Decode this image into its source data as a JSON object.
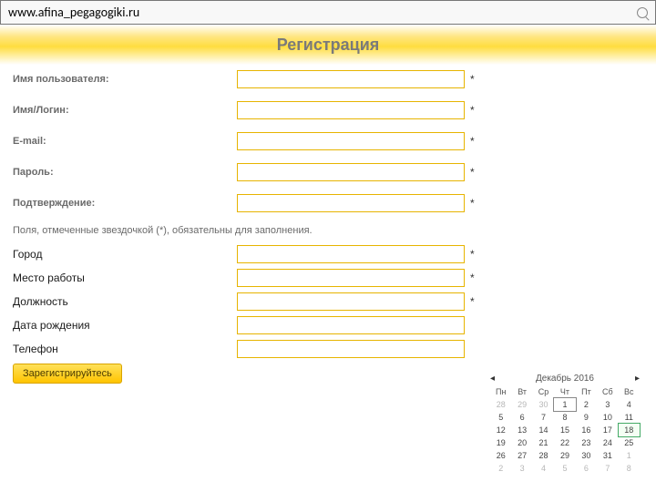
{
  "url": "www.afina_pegagogiki.ru",
  "title": "Регистрация",
  "fields_top": [
    {
      "label": "Имя пользователя:",
      "required": true
    },
    {
      "label": "Имя/Логин:",
      "required": true
    },
    {
      "label": "E-mail:",
      "required": true
    },
    {
      "label": "Пароль:",
      "required": true
    },
    {
      "label": "Подтверждение:",
      "required": true
    }
  ],
  "note": "Поля, отмеченные звездочкой (*), обязательны для заполнения.",
  "fields_bottom": [
    {
      "label": "Город",
      "required": true
    },
    {
      "label": "Место работы",
      "required": true
    },
    {
      "label": "Должность",
      "required": true
    },
    {
      "label": "Дата рождения",
      "required": false
    },
    {
      "label": "Телефон",
      "required": false
    }
  ],
  "submit_label": "Зарегистрируйтесь",
  "star": "*",
  "calendar": {
    "prev": "◂",
    "next": "▸",
    "month": "Декабрь 2016",
    "dow": [
      "Пн",
      "Вт",
      "Ср",
      "Чт",
      "Пт",
      "Сб",
      "Вс"
    ],
    "rows": [
      [
        {
          "d": "28",
          "o": 1
        },
        {
          "d": "29",
          "o": 1
        },
        {
          "d": "30",
          "o": 1
        },
        {
          "d": "1",
          "t": 1
        },
        {
          "d": "2"
        },
        {
          "d": "3"
        },
        {
          "d": "4"
        }
      ],
      [
        {
          "d": "5"
        },
        {
          "d": "6"
        },
        {
          "d": "7"
        },
        {
          "d": "8"
        },
        {
          "d": "9"
        },
        {
          "d": "10"
        },
        {
          "d": "11"
        }
      ],
      [
        {
          "d": "12"
        },
        {
          "d": "13"
        },
        {
          "d": "14"
        },
        {
          "d": "15"
        },
        {
          "d": "16"
        },
        {
          "d": "17"
        },
        {
          "d": "18",
          "s": 1
        }
      ],
      [
        {
          "d": "19"
        },
        {
          "d": "20"
        },
        {
          "d": "21"
        },
        {
          "d": "22"
        },
        {
          "d": "23"
        },
        {
          "d": "24"
        },
        {
          "d": "25"
        }
      ],
      [
        {
          "d": "26"
        },
        {
          "d": "27"
        },
        {
          "d": "28"
        },
        {
          "d": "29"
        },
        {
          "d": "30"
        },
        {
          "d": "31"
        },
        {
          "d": "1",
          "o": 1
        }
      ],
      [
        {
          "d": "2",
          "o": 1
        },
        {
          "d": "3",
          "o": 1
        },
        {
          "d": "4",
          "o": 1
        },
        {
          "d": "5",
          "o": 1
        },
        {
          "d": "6",
          "o": 1
        },
        {
          "d": "7",
          "o": 1
        },
        {
          "d": "8",
          "o": 1
        }
      ]
    ]
  }
}
